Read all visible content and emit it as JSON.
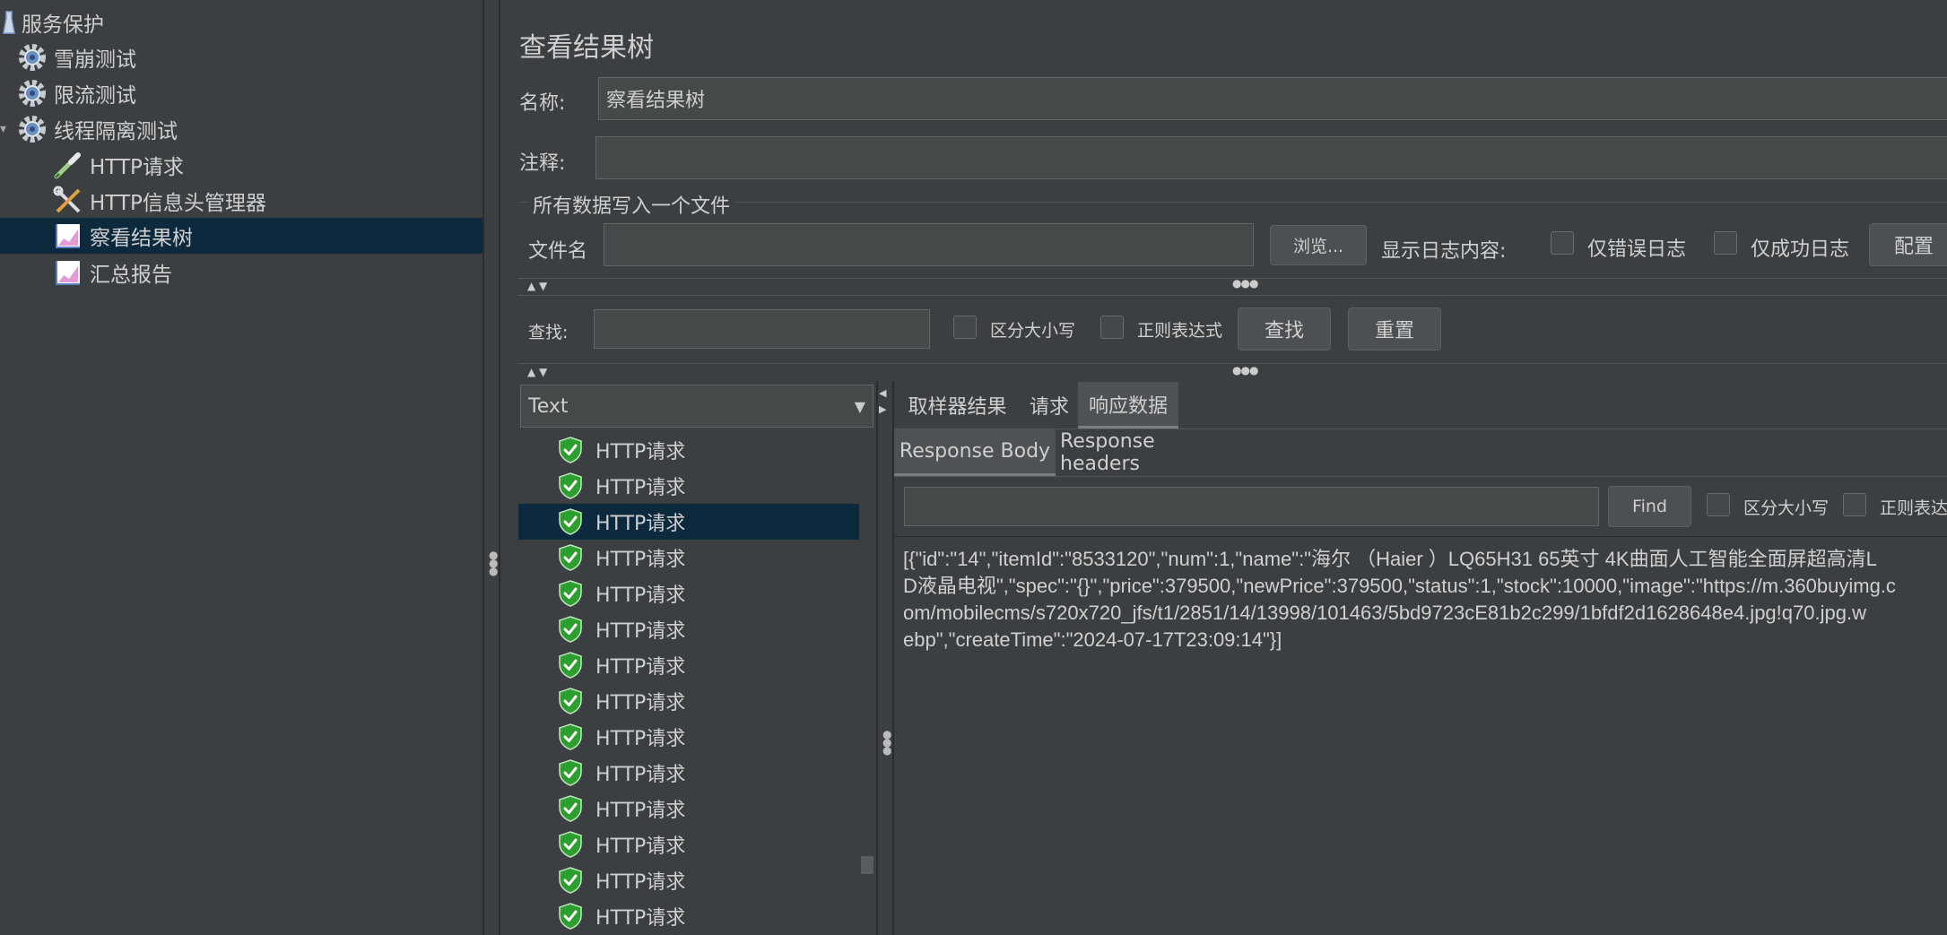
{
  "tree": {
    "items": [
      {
        "label": "服务保护",
        "icon": "flask-icon"
      },
      {
        "label": "雪崩测试",
        "icon": "gear-icon"
      },
      {
        "label": "限流测试",
        "icon": "gear-icon"
      },
      {
        "label": "线程隔离测试",
        "icon": "gear-icon"
      },
      {
        "label": "HTTP请求",
        "icon": "pipette-icon"
      },
      {
        "label": "HTTP信息头管理器",
        "icon": "wrench-icon"
      },
      {
        "label": "察看结果树",
        "icon": "chart-icon"
      },
      {
        "label": "汇总报告",
        "icon": "chart-icon"
      }
    ]
  },
  "panel": {
    "title": "查看结果树",
    "name_label": "名称:",
    "name_value": "察看结果树",
    "comment_label": "注释:",
    "comment_value": "",
    "file_section_title": "所有数据写入一个文件",
    "filename_label": "文件名",
    "filename_value": "",
    "browse_button": "浏览...",
    "log_content_label": "显示日志内容:",
    "errors_only_label": "仅错误日志",
    "success_only_label": "仅成功日志",
    "config_button": "配置"
  },
  "search": {
    "label": "查找:",
    "value": "",
    "case_sensitive_label": "区分大小写",
    "regex_label": "正则表达式",
    "find_button": "查找",
    "reset_button": "重置"
  },
  "results": {
    "renderer_selected": "Text",
    "rows": [
      "HTTP请求",
      "HTTP请求",
      "HTTP请求",
      "HTTP请求",
      "HTTP请求",
      "HTTP请求",
      "HTTP请求",
      "HTTP请求",
      "HTTP请求",
      "HTTP请求",
      "HTTP请求",
      "HTTP请求",
      "HTTP请求",
      "HTTP请求"
    ],
    "selected_index": 2
  },
  "detail": {
    "tabs": [
      "取样器结果",
      "请求",
      "响应数据"
    ],
    "active_tab": 2,
    "subtabs": [
      "Response Body",
      "Response headers"
    ],
    "active_subtab": 0,
    "find_value": "",
    "find_button": "Find",
    "case_sensitive_label": "区分大小写",
    "regex_label": "正则表达",
    "body_lines": [
      "[{\"id\":\"14\",\"itemId\":\"8533120\",\"num\":1,\"name\":\"海尔 （Haier ）LQ65H31 65英寸 4K曲面人工智能全面屏超高清L",
      "D液晶电视\",\"spec\":\"{}\",\"price\":379500,\"newPrice\":379500,\"status\":1,\"stock\":10000,\"image\":\"https://m.360buyimg.c",
      "om/mobilecms/s720x720_jfs/t1/2851/14/13998/101463/5bd9723cE81b2c299/1bfdf2d1628648e4.jpg!q70.jpg.w",
      "ebp\",\"createTime\":\"2024-07-17T23:09:14\"}]"
    ]
  },
  "colors": {
    "background": "#3c3f41",
    "selection": "#0d293e",
    "field": "#45494a",
    "success_shield": "#2e9e2e"
  }
}
